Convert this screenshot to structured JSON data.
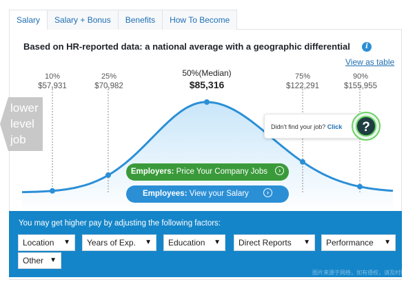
{
  "tabs": [
    {
      "label": "Salary"
    },
    {
      "label": "Salary + Bonus"
    },
    {
      "label": "Benefits"
    },
    {
      "label": "How To Become"
    }
  ],
  "card": {
    "headline": "Based on HR-reported data: a national average with a geographic differential",
    "info_icon": "info-icon",
    "view_table_link": "View as table"
  },
  "chart_data": {
    "type": "area",
    "percentiles": [
      {
        "label": "10%",
        "value": "$57,931",
        "amount": 57931
      },
      {
        "label": "25%",
        "value": "$70,982",
        "amount": 70982
      },
      {
        "label": "50%(Median)",
        "value": "$85,316",
        "amount": 85316
      },
      {
        "label": "75%",
        "value": "$122,291",
        "amount": 122291
      },
      {
        "label": "90%",
        "value": "$155,955",
        "amount": 155955
      }
    ],
    "curve_color": "#2b8fd6",
    "fill_top": "#c9e6f9",
    "fill_bottom": "#ffffff"
  },
  "buttons": {
    "employers_strong": "Employers:",
    "employers_text": " Price Your Company Jobs",
    "employees_strong": "Employees:",
    "employees_text": " View your Salary"
  },
  "help": {
    "text": "Didn't find your job? ",
    "link": "Click",
    "badge": "?"
  },
  "side_tag": {
    "line1": "lower",
    "line2": "level",
    "line3": "job"
  },
  "factors": {
    "title": "You may get higher pay by adjusting the following factors:",
    "selects": [
      {
        "label": "Location"
      },
      {
        "label": "Years of Exp."
      },
      {
        "label": "Education"
      },
      {
        "label": "Direct Reports"
      },
      {
        "label": "Performance"
      },
      {
        "label": "Other"
      }
    ],
    "watermark": "图片来源于网络，如有侵权，请及时联系删除"
  },
  "colors": {
    "accent_blue": "#1585c9",
    "link_blue": "#1f6fb3",
    "green": "#3a9a3a"
  }
}
